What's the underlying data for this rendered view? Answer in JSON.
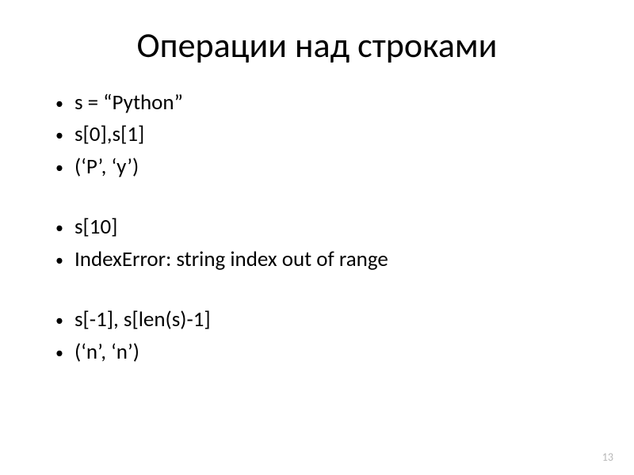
{
  "slide": {
    "title": "Операции над строками",
    "groups": [
      [
        "s = “Python”",
        "s[0],s[1]",
        "(‘P’, ‘y’)"
      ],
      [
        "s[10]",
        "IndexError: string index out of range"
      ],
      [
        "s[-1], s[len(s)-1]",
        "(‘n’, ‘n’)"
      ]
    ],
    "page_number": "13"
  }
}
